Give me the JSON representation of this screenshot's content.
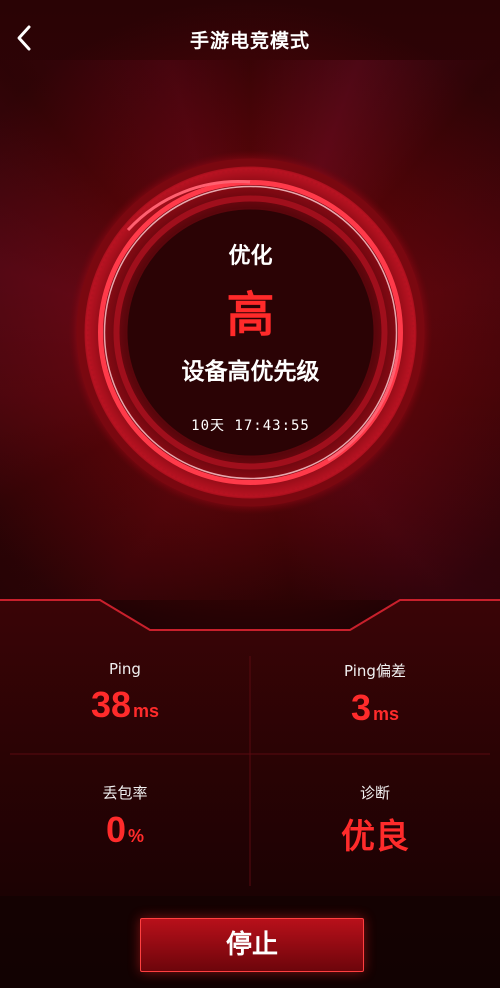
{
  "header": {
    "title": "手游电竞模式",
    "back_icon": "chevron-left-icon"
  },
  "dial": {
    "label": "优化",
    "level": "高",
    "description": "设备高优先级",
    "elapsed": "10天 17:43:55"
  },
  "stats": {
    "ping": {
      "label": "Ping",
      "value": "38",
      "unit": "ms"
    },
    "jitter": {
      "label": "Ping偏差",
      "value": "3",
      "unit": "ms"
    },
    "packet_loss": {
      "label": "丢包率",
      "value": "0",
      "unit": "%"
    },
    "diagnosis": {
      "label": "诊断",
      "value": "优良"
    }
  },
  "actions": {
    "stop_label": "停止"
  },
  "colors": {
    "accent": "#ff2b2b",
    "background": "#1a0203",
    "ring": "#ff3a4a"
  }
}
